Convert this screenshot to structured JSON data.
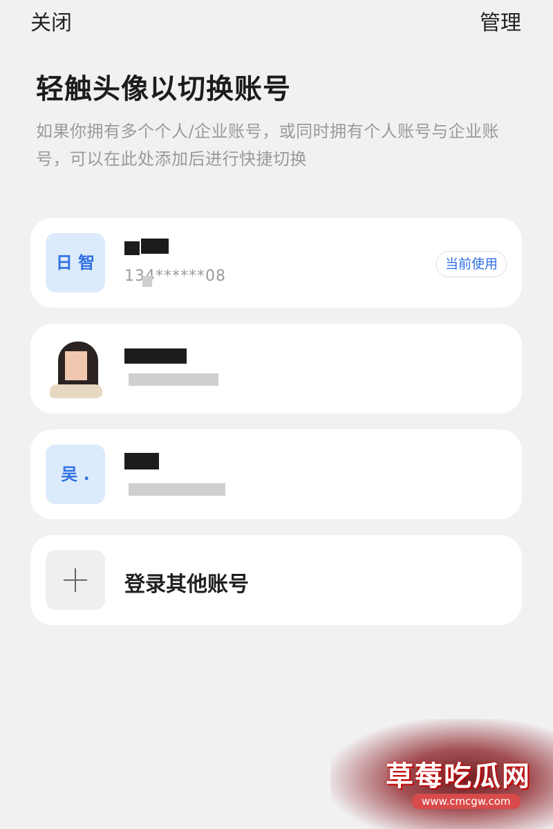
{
  "header": {
    "close_label": "关闭",
    "manage_label": "管理"
  },
  "title": "轻触头像以切换账号",
  "description": "如果你拥有多个个人/企业账号，或同时拥有个人账号与企业账号，可以在此处添加后进行快捷切换",
  "accounts": [
    {
      "avatar_text": "日 智",
      "name": "",
      "phone": "134******08",
      "badge": "当前使用"
    },
    {
      "avatar_text": "",
      "name": "",
      "phone": ""
    },
    {
      "avatar_text": "吴 .",
      "name": "",
      "phone": ""
    }
  ],
  "add_account_label": "登录其他账号",
  "icons": {
    "add": "plus-icon"
  },
  "colors": {
    "accent": "#2f6fe4",
    "background": "#f1f1f3",
    "card": "#ffffff"
  },
  "watermark": {
    "main": "草莓吃瓜网",
    "url": "www.cmcgw.com"
  }
}
